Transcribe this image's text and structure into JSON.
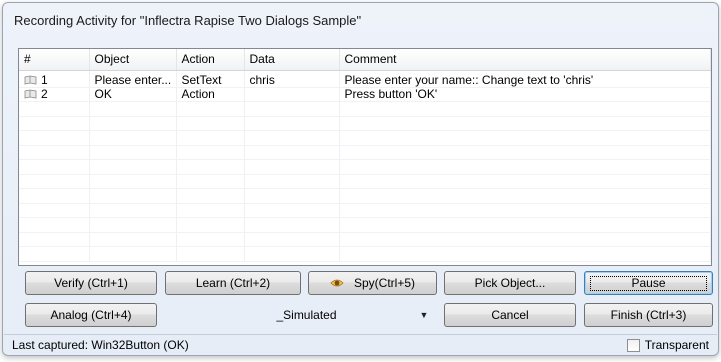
{
  "window": {
    "title": "Recording Activity for \"Inflectra Rapise Two Dialogs Sample\""
  },
  "grid": {
    "columns": [
      "#",
      "Object",
      "Action",
      "Data",
      "Comment"
    ],
    "rows": [
      {
        "num": "1",
        "object": "Please enter...",
        "action": "SetText",
        "data": "chris",
        "comment": "Please enter your name:: Change text to 'chris'"
      },
      {
        "num": "2",
        "object": "OK",
        "action": "Action",
        "data": "",
        "comment": "Press button 'OK'"
      }
    ],
    "row_icon": "step-icon"
  },
  "buttons": {
    "verify": "Verify (Ctrl+1)",
    "learn": "Learn (Ctrl+2)",
    "spy": "Spy(Ctrl+5)",
    "pick_object": "Pick Object...",
    "pause": "Pause",
    "analog": "Analog (Ctrl+4)",
    "cancel": "Cancel",
    "finish": "Finish (Ctrl+3)"
  },
  "mode_select": {
    "value": "_Simulated"
  },
  "status": {
    "last_captured": "Last captured: Win32Button (OK)",
    "transparent_label": "Transparent",
    "transparent_checked": false
  }
}
